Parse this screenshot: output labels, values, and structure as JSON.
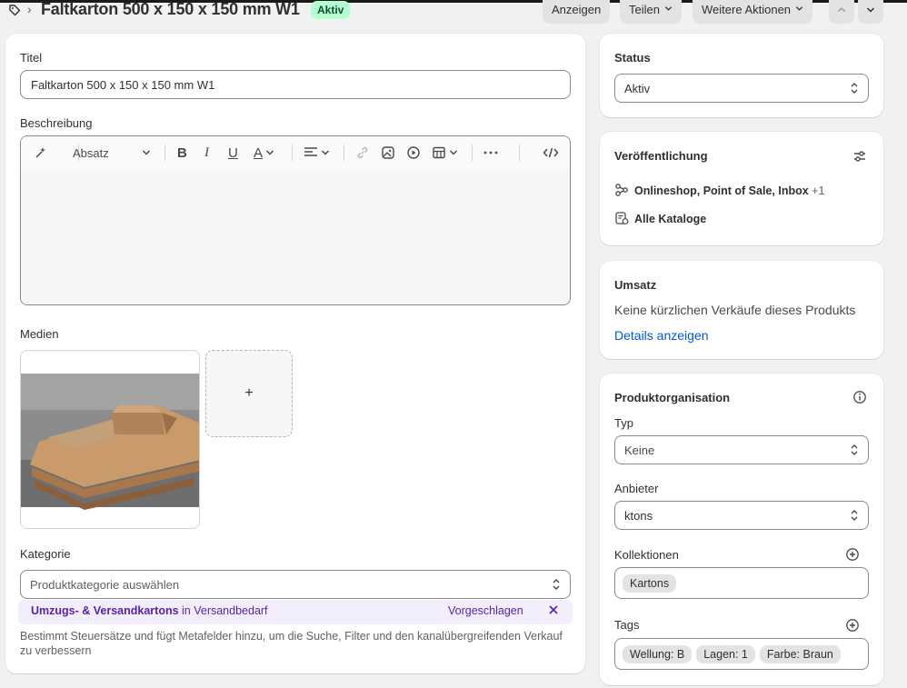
{
  "header": {
    "title": "Faltkarton 500 x 150 x 150 mm W1",
    "status_badge": "Aktiv",
    "buttons": {
      "view": "Anzeigen",
      "share": "Teilen",
      "more": "Weitere Aktionen"
    }
  },
  "main": {
    "title_label": "Titel",
    "title_value": "Faltkarton 500 x 150 x 150 mm W1",
    "description_label": "Beschreibung",
    "editor": {
      "paragraph_select": "Absatz"
    },
    "media_label": "Medien",
    "media_add": "+",
    "category": {
      "label": "Kategorie",
      "placeholder": "Produktkategorie auswählen",
      "suggestion_main": "Umzugs- & Versandkartons",
      "suggestion_rest": " in Versandbedarf",
      "suggestion_action": "Vorgeschlagen",
      "help": "Bestimmt Steuersätze und fügt Metafelder hinzu, um die Suche, Filter und den kanalübergreifenden Verkauf zu verbessern"
    }
  },
  "sidebar": {
    "status": {
      "title": "Status",
      "value": "Aktiv"
    },
    "publishing": {
      "title": "Veröffentlichung",
      "channels": "Onlineshop, Point of Sale, Inbox",
      "channels_more": "+1",
      "catalogs": "Alle Kataloge"
    },
    "sales": {
      "title": "Umsatz",
      "text": "Keine kürzlichen Verkäufe dieses Produkts",
      "link": "Details anzeigen"
    },
    "organization": {
      "title": "Produktorganisation",
      "type_label": "Typ",
      "type_value": "Keine",
      "vendor_label": "Anbieter",
      "vendor_value": "ktons",
      "collections_label": "Kollektionen",
      "collections": [
        "Kartons"
      ],
      "tags_label": "Tags",
      "tags": [
        "Wellung: B",
        "Lagen: 1",
        "Farbe: Braun"
      ]
    }
  },
  "colors": {
    "badge_bg": "#b4fed2",
    "link": "#005bd3",
    "suggestion_bg": "#f2eefb",
    "suggestion_text": "#5a1fa8"
  }
}
